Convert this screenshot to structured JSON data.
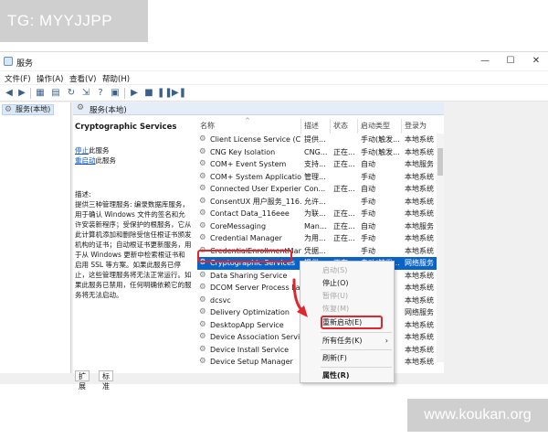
{
  "watermark_top": "TG: MYYJJPP",
  "watermark_bottom": "www.koukan.org",
  "window": {
    "title": "服务",
    "controls": {
      "minimize": "—",
      "maximize": "☐",
      "close": "✕"
    }
  },
  "menu": [
    "文件(F)",
    "操作(A)",
    "查看(V)",
    "帮助(H)"
  ],
  "tree": {
    "root": "服务(本地)"
  },
  "pane_header": "服务(本地)",
  "detail": {
    "service_name": "Cryptographic Services",
    "stop_link": "停止",
    "stop_suffix": "此服务",
    "restart_link": "重启动",
    "restart_suffix": "此服务",
    "desc_title": "描述:",
    "desc_body": "提供三种管理服务: 编录数据库服务，用于确认 Windows 文件的签名和允许安装新程序；受保护的根服务，它从此计算机添加和删除受信任根证书颁发机构的证书；自动根证书更新服务，用于从 Windows 更新中检索根证书和启用 SSL 等方案。如果此服务已停止，这些管理服务将无法正常运行。如果此服务已禁用，任何明确依赖它的服务将无法启动。"
  },
  "columns": {
    "name": "名称",
    "desc": "描述",
    "status": "状态",
    "startup": "启动类型",
    "logon": "登录为"
  },
  "services": [
    {
      "name": "Client License Service (Cli...",
      "desc": "提供...",
      "status": "",
      "startup": "手动(触发...",
      "logon": "本地系统"
    },
    {
      "name": "CNG Key Isolation",
      "desc": "CNG...",
      "status": "正在...",
      "startup": "手动(触发...",
      "logon": "本地系统"
    },
    {
      "name": "COM+ Event System",
      "desc": "支持...",
      "status": "正在...",
      "startup": "自动",
      "logon": "本地服务"
    },
    {
      "name": "COM+ System Application",
      "desc": "管理...",
      "status": "",
      "startup": "手动",
      "logon": "本地系统"
    },
    {
      "name": "Connected User Experien...",
      "desc": "Con...",
      "status": "正在...",
      "startup": "自动",
      "logon": "本地系统"
    },
    {
      "name": "ConsentUX 用户服务_116...",
      "desc": "允许...",
      "status": "",
      "startup": "手动",
      "logon": "本地系统"
    },
    {
      "name": "Contact Data_116eee",
      "desc": "为联...",
      "status": "正在...",
      "startup": "手动",
      "logon": "本地系统"
    },
    {
      "name": "CoreMessaging",
      "desc": "Man...",
      "status": "正在...",
      "startup": "自动",
      "logon": "本地服务"
    },
    {
      "name": "Credential Manager",
      "desc": "为用...",
      "status": "正在...",
      "startup": "手动",
      "logon": "本地系统"
    },
    {
      "name": "CredentialEnrollmentMan...",
      "desc": "凭据...",
      "status": "",
      "startup": "手动",
      "logon": "本地系统"
    },
    {
      "name": "Cryptographic Services",
      "desc": "提供...",
      "status": "正在...",
      "startup": "自动(触发...",
      "logon": "网络服务"
    },
    {
      "name": "Data Sharing Service",
      "desc": "",
      "status": "",
      "startup": "",
      "logon": "本地系统"
    },
    {
      "name": "DCOM Server Process La...",
      "desc": "",
      "status": "",
      "startup": "",
      "logon": "本地系统"
    },
    {
      "name": "dcsvc",
      "desc": "",
      "status": "",
      "startup": "",
      "logon": "本地系统"
    },
    {
      "name": "Delivery Optimization",
      "desc": "",
      "status": "",
      "startup": "",
      "logon": "网络服务"
    },
    {
      "name": "DesktopApp Service",
      "desc": "",
      "status": "",
      "startup": "",
      "logon": "本地系统"
    },
    {
      "name": "Device Association Service",
      "desc": "",
      "status": "",
      "startup": "",
      "logon": "本地系统"
    },
    {
      "name": "Device Install Service",
      "desc": "",
      "status": "",
      "startup": "",
      "logon": "本地系统"
    },
    {
      "name": "Device Setup Manager",
      "desc": "",
      "status": "",
      "startup": "",
      "logon": "本地系统"
    }
  ],
  "context_menu": {
    "start": "启动(S)",
    "stop": "停止(O)",
    "pause": "暂停(U)",
    "resume": "恢复(M)",
    "restart": "重新启动(E)",
    "all_tasks": "所有任务(K)",
    "all_tasks_arrow": "›",
    "refresh": "刷新(F)",
    "properties": "属性(R)"
  },
  "tabs": [
    "扩展",
    "标准"
  ],
  "colors": {
    "selection": "#0a64c8",
    "highlight": "#e0262c",
    "link": "#0b57c5"
  }
}
